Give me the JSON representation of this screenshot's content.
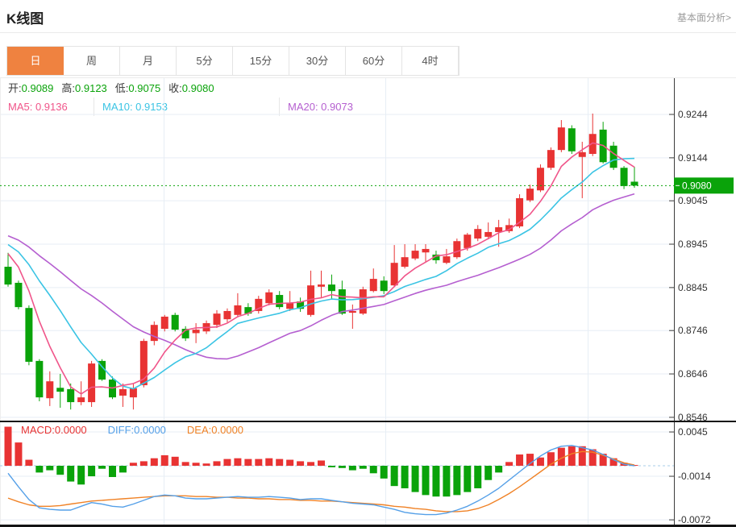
{
  "header": {
    "title": "K线图",
    "link_label": "基本面分析>"
  },
  "tabs": {
    "items": [
      "日",
      "周",
      "月",
      "5分",
      "15分",
      "30分",
      "60分",
      "4时"
    ],
    "active_index": 0
  },
  "info_bar": {
    "row1": [
      {
        "label": "开",
        "value": "0.9089"
      },
      {
        "label": "高",
        "value": "0.9123"
      },
      {
        "label": "低",
        "value": "0.9075"
      },
      {
        "label": "收",
        "value": "0.9080"
      }
    ],
    "row2": [
      {
        "label": "MA5",
        "value": "0.9136",
        "color_key": "ma5"
      },
      {
        "label": "MA10",
        "value": "0.9153",
        "color_key": "ma10"
      },
      {
        "label": "MA20",
        "value": "0.9073",
        "color_key": "ma20"
      }
    ]
  },
  "macd_info": [
    {
      "label": "MACD",
      "value": "0.0000",
      "color_key": "up"
    },
    {
      "label": "DIFF",
      "value": "0.0000",
      "color_key": "diff"
    },
    {
      "label": "DEA",
      "value": "0.0000",
      "color_key": "dea"
    }
  ],
  "colors": {
    "up": "#e83333",
    "down": "#0aa30a",
    "ma5": "#f0558a",
    "ma10": "#3bc4e4",
    "ma20": "#b55fd0",
    "diff": "#55a0e8",
    "dea": "#f08226",
    "tab_accent": "#ef8240",
    "badge": "#0aa30a",
    "grid": "#e7eef5",
    "axis": "#3c3c3c",
    "text": "#333333",
    "border_dark": "#141414",
    "link": "#9b9b9b"
  },
  "chart_data": [
    {
      "type": "candlestick",
      "title": "K线图 (daily candles with MA5/MA10/MA20)",
      "legend": [
        "MA5",
        "MA10",
        "MA20"
      ],
      "y_axis_labels": [
        {
          "label": "0.9244",
          "price": 0.9244
        },
        {
          "label": "0.9144",
          "price": 0.9144
        },
        {
          "label": "0.9045",
          "price": 0.9045
        },
        {
          "label": "0.8945",
          "price": 0.8945
        },
        {
          "label": "0.8845",
          "price": 0.8845
        },
        {
          "label": "0.8746",
          "price": 0.8746
        },
        {
          "label": "0.8646",
          "price": 0.8646
        },
        {
          "label": "0.8546",
          "price": 0.8546
        }
      ],
      "ylim": [
        0.853,
        0.926
      ],
      "current_price": 0.908,
      "current_price_label": "0.9080",
      "x_gridlines": [
        203,
        478,
        729
      ],
      "grid": true,
      "legend_position": "top-left",
      "last_candle_ohlc": {
        "open": 0.9089,
        "high": 0.9123,
        "low": 0.9075,
        "close": 0.908
      },
      "lead_in_closes": [
        0.9,
        0.8995,
        0.899,
        0.8988,
        0.8985,
        0.8982,
        0.898,
        0.8978,
        0.8975,
        0.8972,
        0.897,
        0.8968,
        0.8965,
        0.8962,
        0.896,
        0.8955,
        0.895,
        0.894,
        0.892
      ],
      "candles_ohlc": [
        [
          0.8893,
          0.8925,
          0.8847,
          0.8852
        ],
        [
          0.8856,
          0.8861,
          0.8795,
          0.88
        ],
        [
          0.8798,
          0.8804,
          0.8666,
          0.8674
        ],
        [
          0.8676,
          0.868,
          0.8583,
          0.8592
        ],
        [
          0.859,
          0.8652,
          0.8572,
          0.8629
        ],
        [
          0.8614,
          0.8646,
          0.8568,
          0.8605
        ],
        [
          0.8611,
          0.8624,
          0.8564,
          0.8581
        ],
        [
          0.8581,
          0.8629,
          0.8574,
          0.8592
        ],
        [
          0.8581,
          0.8676,
          0.857,
          0.867
        ],
        [
          0.8676,
          0.868,
          0.863,
          0.8633
        ],
        [
          0.8633,
          0.864,
          0.8588,
          0.8592
        ],
        [
          0.8596,
          0.8624,
          0.857,
          0.8611
        ],
        [
          0.8592,
          0.8624,
          0.8564,
          0.8613
        ],
        [
          0.862,
          0.8727,
          0.8615,
          0.8722
        ],
        [
          0.8722,
          0.8767,
          0.8712,
          0.8759
        ],
        [
          0.875,
          0.8782,
          0.8744,
          0.8778
        ],
        [
          0.8782,
          0.8787,
          0.8744,
          0.8748
        ],
        [
          0.875,
          0.8756,
          0.8722,
          0.8728
        ],
        [
          0.874,
          0.8763,
          0.8717,
          0.8748
        ],
        [
          0.8744,
          0.8769,
          0.8738,
          0.8763
        ],
        [
          0.8759,
          0.8793,
          0.8752,
          0.8785
        ],
        [
          0.8772,
          0.8797,
          0.8765,
          0.8791
        ],
        [
          0.8782,
          0.8832,
          0.8776,
          0.8804
        ],
        [
          0.88,
          0.8809,
          0.878,
          0.8785
        ],
        [
          0.8791,
          0.8826,
          0.8785,
          0.8819
        ],
        [
          0.8809,
          0.8841,
          0.8804,
          0.8834
        ],
        [
          0.8828,
          0.8837,
          0.8795,
          0.88
        ],
        [
          0.8796,
          0.8837,
          0.8791,
          0.8809
        ],
        [
          0.8813,
          0.8822,
          0.8789,
          0.8796
        ],
        [
          0.8782,
          0.8884,
          0.8778,
          0.885
        ],
        [
          0.8847,
          0.8884,
          0.8822,
          0.8852
        ],
        [
          0.8852,
          0.8875,
          0.8819,
          0.8837
        ],
        [
          0.8841,
          0.8861,
          0.8782,
          0.8785
        ],
        [
          0.8787,
          0.8806,
          0.875,
          0.8791
        ],
        [
          0.8785,
          0.8847,
          0.8782,
          0.8841
        ],
        [
          0.8837,
          0.8889,
          0.8834,
          0.8865
        ],
        [
          0.8861,
          0.8871,
          0.883,
          0.8837
        ],
        [
          0.885,
          0.8943,
          0.8847,
          0.8902
        ],
        [
          0.8893,
          0.8945,
          0.8889,
          0.8915
        ],
        [
          0.8912,
          0.8945,
          0.8908,
          0.893
        ],
        [
          0.8926,
          0.8945,
          0.8904,
          0.8934
        ],
        [
          0.8921,
          0.893,
          0.89,
          0.8908
        ],
        [
          0.8902,
          0.8934,
          0.8899,
          0.8917
        ],
        [
          0.8915,
          0.8958,
          0.8911,
          0.8952
        ],
        [
          0.8936,
          0.8971,
          0.893,
          0.8967
        ],
        [
          0.8958,
          0.8989,
          0.8952,
          0.898
        ],
        [
          0.8962,
          0.8995,
          0.8956,
          0.8973
        ],
        [
          0.8973,
          0.9001,
          0.8939,
          0.8984
        ],
        [
          0.8975,
          0.9004,
          0.8971,
          0.8989
        ],
        [
          0.8986,
          0.906,
          0.8982,
          0.9051
        ],
        [
          0.9046,
          0.9082,
          0.9042,
          0.9073
        ],
        [
          0.9069,
          0.9129,
          0.9065,
          0.9121
        ],
        [
          0.9121,
          0.9168,
          0.9116,
          0.9162
        ],
        [
          0.9162,
          0.9231,
          0.9157,
          0.9214
        ],
        [
          0.9212,
          0.9219,
          0.9153,
          0.9159
        ],
        [
          0.9146,
          0.9181,
          0.9051,
          0.9157
        ],
        [
          0.9153,
          0.9246,
          0.9148,
          0.9199
        ],
        [
          0.9209,
          0.9227,
          0.9131,
          0.9134
        ],
        [
          0.9172,
          0.9181,
          0.9116,
          0.9121
        ],
        [
          0.9121,
          0.9125,
          0.9072,
          0.9079
        ],
        [
          0.9089,
          0.9123,
          0.9075,
          0.908
        ]
      ]
    },
    {
      "type": "bar",
      "title": "MACD(12,26,9)",
      "legend": [
        "MACD",
        "DIFF",
        "DEA"
      ],
      "y_axis_labels": [
        {
          "label": "0.0045",
          "value": 0.0045
        },
        {
          "label": "-0.0014",
          "value": -0.0014
        },
        {
          "label": "-0.0072",
          "value": -0.0072
        }
      ],
      "ylim": [
        -0.0082,
        0.0058
      ],
      "zero_line": 0,
      "x_gridlines": [
        203,
        478,
        729
      ],
      "hist": [
        0.0052,
        0.0031,
        0.0008,
        -0.0009,
        -0.0006,
        -0.0012,
        -0.0021,
        -0.0025,
        -0.0014,
        -0.0004,
        -0.0015,
        -0.0009,
        0.0004,
        0.0006,
        0.001,
        0.0014,
        0.0012,
        0.0005,
        0.0004,
        0.0003,
        0.0006,
        0.0009,
        0.001,
        0.0009,
        0.0009,
        0.001,
        0.0009,
        0.0008,
        0.0006,
        0.0005,
        0.0007,
        -0.0002,
        -0.0003,
        -0.0006,
        -0.0004,
        -0.001,
        -0.0017,
        -0.0027,
        -0.003,
        -0.0035,
        -0.0039,
        -0.0041,
        -0.0041,
        -0.0039,
        -0.0035,
        -0.003,
        -0.0019,
        -0.0009,
        0.0005,
        0.0015,
        0.0016,
        0.0011,
        0.0018,
        0.0024,
        0.0026,
        0.0026,
        0.0022,
        0.0016,
        0.001,
        0.0004,
        0.0001
      ],
      "diff": [
        -0.001,
        -0.0028,
        -0.0045,
        -0.0056,
        -0.0058,
        -0.0059,
        -0.0059,
        -0.0054,
        -0.0049,
        -0.0051,
        -0.0054,
        -0.0055,
        -0.0051,
        -0.0046,
        -0.0041,
        -0.0039,
        -0.004,
        -0.0043,
        -0.0044,
        -0.0044,
        -0.0043,
        -0.0042,
        -0.0041,
        -0.0042,
        -0.0042,
        -0.0041,
        -0.0042,
        -0.0043,
        -0.0045,
        -0.0044,
        -0.0044,
        -0.0046,
        -0.0048,
        -0.005,
        -0.0051,
        -0.0052,
        -0.0055,
        -0.0058,
        -0.0062,
        -0.0064,
        -0.0065,
        -0.0065,
        -0.0063,
        -0.0059,
        -0.0054,
        -0.0047,
        -0.0039,
        -0.003,
        -0.0019,
        -0.0008,
        0.0003,
        0.0013,
        0.0021,
        0.0026,
        0.0027,
        0.0024,
        0.0021,
        0.0015,
        0.0008,
        0.0002,
        0.0
      ],
      "dea": [
        -0.0043,
        -0.0048,
        -0.0052,
        -0.0054,
        -0.0054,
        -0.0053,
        -0.0051,
        -0.0049,
        -0.0047,
        -0.0046,
        -0.0045,
        -0.0044,
        -0.0043,
        -0.0042,
        -0.0041,
        -0.004,
        -0.004,
        -0.004,
        -0.0041,
        -0.0041,
        -0.0042,
        -0.0042,
        -0.0043,
        -0.0043,
        -0.0044,
        -0.0044,
        -0.0045,
        -0.0045,
        -0.0046,
        -0.0046,
        -0.0047,
        -0.0047,
        -0.0048,
        -0.0049,
        -0.005,
        -0.0051,
        -0.0052,
        -0.0054,
        -0.0055,
        -0.0057,
        -0.0058,
        -0.006,
        -0.0061,
        -0.0061,
        -0.006,
        -0.0057,
        -0.0052,
        -0.0045,
        -0.0037,
        -0.0028,
        -0.0018,
        -0.0008,
        0.0002,
        0.001,
        0.0016,
        0.0019,
        0.0018,
        0.0014,
        0.0009,
        0.0004,
        0.0001
      ]
    }
  ]
}
